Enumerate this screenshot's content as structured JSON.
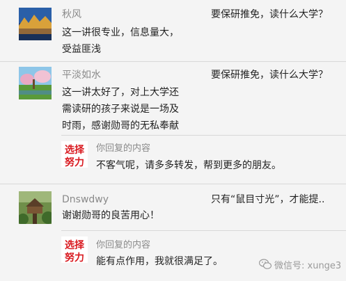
{
  "comments": [
    {
      "name": "秋风",
      "article": "要保研推免，读什么大学？",
      "lines": [
        "这一讲很专业，信息量大，",
        "受益匪浅"
      ],
      "avatar_icon": "landscape-photo-lake"
    },
    {
      "name": "平淡如水",
      "article": "要保研推免，读什么大学？",
      "lines": [
        "这一讲太好了，对上大学还",
        "需读研的孩子来说是一场及",
        "时雨，感谢勋哥的无私奉献"
      ],
      "avatar_icon": "landscape-photo-blossom",
      "reply": {
        "label": "你回复的内容",
        "text": "不客气呢，请多多转发，帮到更多的朋友。",
        "logo_text": [
          "选择",
          "努力"
        ],
        "logo_color": "#d9191f"
      }
    },
    {
      "name": "Dnswdwy",
      "article": "只有“鼠目寸光”，才能提..",
      "lines": [
        "谢谢勋哥的良苦用心！"
      ],
      "avatar_icon": "treehouse-photo",
      "reply": {
        "label": "你回复的内容",
        "text": "能有点作用，我就很满足了。",
        "logo_text": [
          "选择",
          "努力"
        ],
        "logo_color": "#d9191f"
      }
    }
  ],
  "watermark": {
    "text": "微信号: xunge3",
    "icon": "wechat-icon"
  }
}
